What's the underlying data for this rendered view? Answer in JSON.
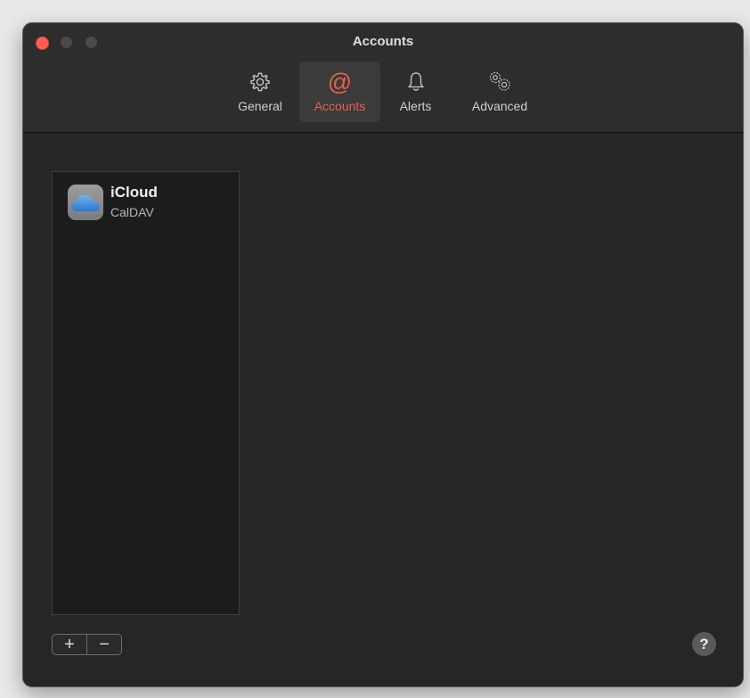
{
  "window": {
    "title": "Accounts"
  },
  "toolbar": {
    "tabs": [
      {
        "label": "General",
        "icon": "gear-icon"
      },
      {
        "label": "Accounts",
        "icon": "at-sign-icon",
        "active": true
      },
      {
        "label": "Alerts",
        "icon": "bell-icon"
      },
      {
        "label": "Advanced",
        "icon": "gears-icon"
      }
    ]
  },
  "accounts": {
    "items": [
      {
        "name": "iCloud",
        "type": "CalDAV",
        "icon": "icloud-icon"
      }
    ]
  },
  "footer": {
    "add_label": "+",
    "remove_label": "−",
    "help_label": "?"
  },
  "colors": {
    "accent": "#ec5e4f",
    "window_bg": "#262626",
    "close": "#ff5f57"
  }
}
